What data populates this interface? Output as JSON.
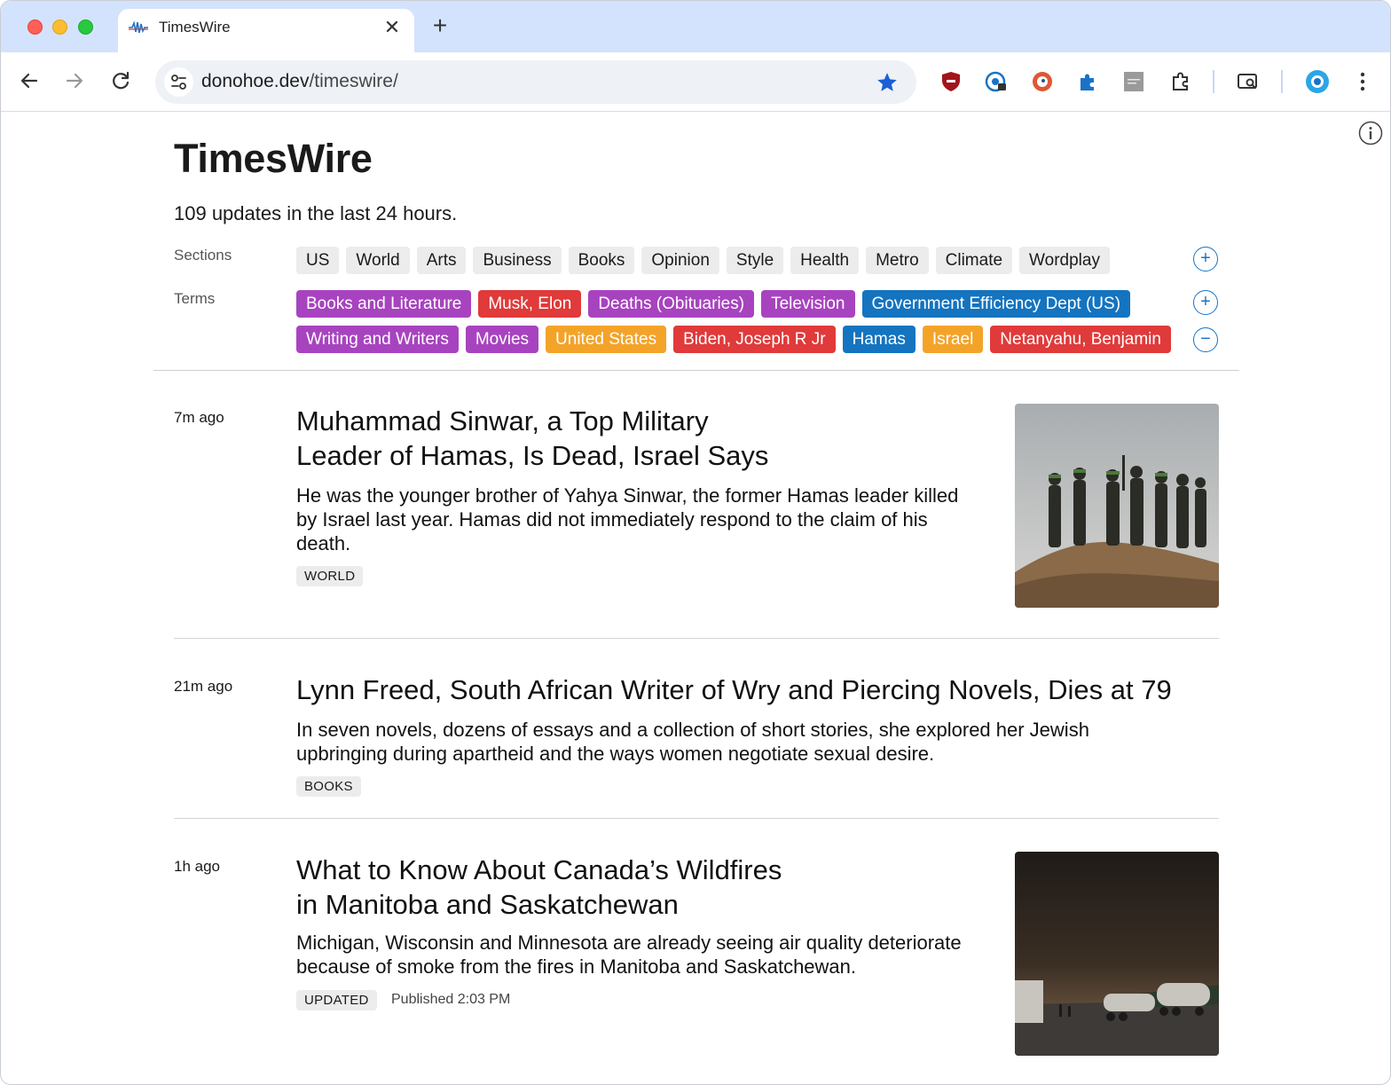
{
  "browser": {
    "tab_title": "TimesWire",
    "tab_close": "✕",
    "new_tab": "+",
    "url_host": "donohoe.dev",
    "url_path": "/timeswire/"
  },
  "page": {
    "title": "TimesWire",
    "updates_text": "109 updates in the last 24 hours.",
    "sections_label": "Sections",
    "terms_label": "Terms",
    "sections": [
      "US",
      "World",
      "Arts",
      "Business",
      "Books",
      "Opinion",
      "Style",
      "Health",
      "Metro",
      "Climate",
      "Wordplay"
    ],
    "terms_row1": [
      {
        "label": "Books and Literature",
        "color": "#a843c0"
      },
      {
        "label": "Musk, Elon",
        "color": "#e03a3a"
      },
      {
        "label": "Deaths (Obituaries)",
        "color": "#a843c0"
      },
      {
        "label": "Television",
        "color": "#a843c0"
      },
      {
        "label": "Government Efficiency Dept (US)",
        "color": "#1474c0"
      }
    ],
    "terms_row2": [
      {
        "label": "Writing and Writers",
        "color": "#a843c0"
      },
      {
        "label": "Movies",
        "color": "#a843c0"
      },
      {
        "label": "United States",
        "color": "#f4a329"
      },
      {
        "label": "Biden, Joseph R Jr",
        "color": "#e03a3a"
      },
      {
        "label": "Hamas",
        "color": "#1474c0"
      },
      {
        "label": "Israel",
        "color": "#f4a329"
      },
      {
        "label": "Netanyahu, Benjamin",
        "color": "#e03a3a"
      }
    ],
    "add_section": "+",
    "add_term": "+",
    "remove_term": "−"
  },
  "articles": [
    {
      "time": "7m ago",
      "headline_line1": "Muhammad Sinwar, a Top Military",
      "headline_line2": "Leader of Hamas, Is Dead, Israel Says",
      "dek_line1": "He was the younger brother of Yahya Sinwar, the former Hamas leader killed",
      "dek_line2": "by Israel last year. Hamas did not immediately respond to the claim of his",
      "dek_line3": "death.",
      "tag": "WORLD"
    },
    {
      "time": "21m ago",
      "headline_line1": "Lynn Freed, South African Writer of Wry and Piercing Novels, Dies at 79",
      "dek_line1": "In seven novels, dozens of essays and a collection of short stories, she explored her Jewish",
      "dek_line2": "upbringing during apartheid and the ways women negotiate sexual desire.",
      "tag": "BOOKS"
    },
    {
      "time": "1h ago",
      "headline_line1": "What to Know About Canada’s Wildfires",
      "headline_line2": "in Manitoba and Saskatchewan",
      "dek_line1": "Michigan, Wisconsin and Minnesota are already seeing air quality deteriorate",
      "dek_line2": "because of smoke from the fires in Manitoba and Saskatchewan.",
      "tag": "UPDATED",
      "published": "Published 2:03 PM"
    }
  ],
  "colors": {
    "accent_blue": "#1a73c8",
    "term_purple": "#a843c0",
    "term_red": "#e03a3a",
    "term_blue": "#1474c0",
    "term_orange": "#f4a329"
  }
}
